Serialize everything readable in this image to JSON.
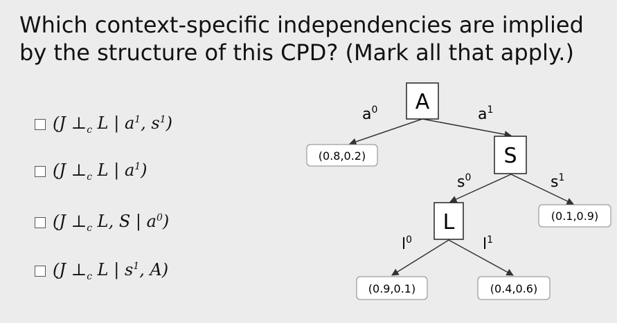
{
  "question": "Which context-specific independencies are implied by the structure of this CPD? (Mark all that apply.)",
  "options": [
    {
      "pre": "(J ⊥",
      "sub": "c",
      "mid": " L | a",
      "sup1": "1",
      "mid2": ", s",
      "sup2": "1",
      "post": ")"
    },
    {
      "pre": "(J ⊥",
      "sub": "c",
      "mid": " L | a",
      "sup1": "1",
      "mid2": "",
      "sup2": "",
      "post": ")"
    },
    {
      "pre": "(J ⊥",
      "sub": "c",
      "mid": " L, S | a",
      "sup1": "0",
      "mid2": "",
      "sup2": "",
      "post": ")"
    },
    {
      "pre": "(J ⊥",
      "sub": "c",
      "mid": " L | s",
      "sup1": "1",
      "mid2": ", A",
      "sup2": "",
      "post": ")"
    }
  ],
  "tree": {
    "nodes": {
      "A": "A",
      "S": "S",
      "L": "L"
    },
    "edges": {
      "a0": {
        "base": "a",
        "sup": "0"
      },
      "a1": {
        "base": "a",
        "sup": "1"
      },
      "s0": {
        "base": "s",
        "sup": "0"
      },
      "s1": {
        "base": "s",
        "sup": "1"
      },
      "l0": {
        "base": "l",
        "sup": "0"
      },
      "l1": {
        "base": "l",
        "sup": "1"
      }
    },
    "leaves": {
      "a0_leaf": "(0.8,0.2)",
      "s1_leaf": "(0.1,0.9)",
      "l0_leaf": "(0.9,0.1)",
      "l1_leaf": "(0.4,0.6)"
    }
  }
}
